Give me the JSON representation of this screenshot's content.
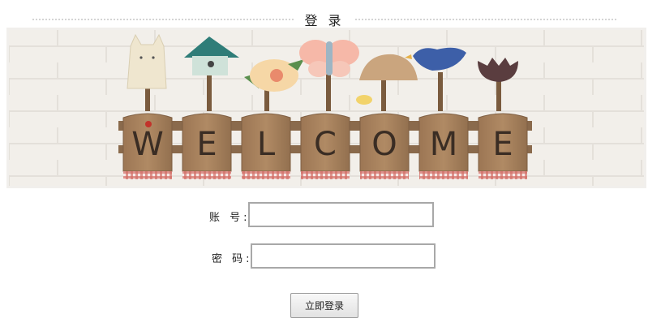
{
  "page": {
    "title": "登 录"
  },
  "banner": {
    "letters": [
      "W",
      "E",
      "L",
      "C",
      "O",
      "M",
      "E"
    ]
  },
  "login": {
    "account_label": "账 号:",
    "account_value": "",
    "password_label": "密 码:",
    "password_value": "",
    "submit_label": "立即登录"
  },
  "colors": {
    "wood": "#a27d58",
    "letter": "#3a2d24",
    "birdhouse_roof": "#2f7d78",
    "bird": "#3d5fa8",
    "gingham": "#c9564f"
  }
}
